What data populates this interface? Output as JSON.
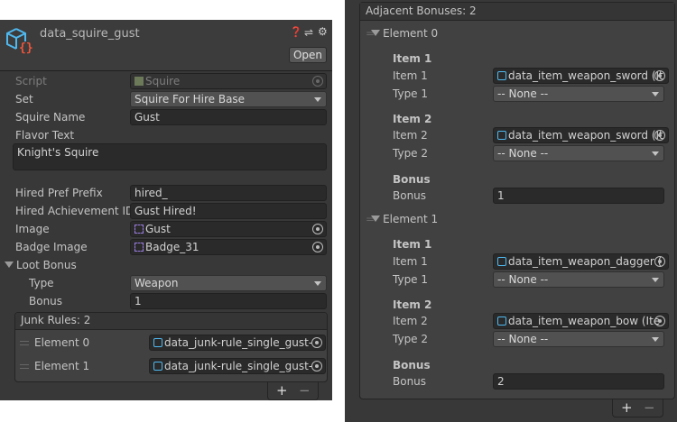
{
  "left": {
    "title": "data_squire_gust",
    "open_label": "Open",
    "fields": {
      "script": {
        "label": "Script",
        "value": "Squire"
      },
      "set": {
        "label": "Set",
        "value": "Squire For Hire Base"
      },
      "squire_name": {
        "label": "Squire Name",
        "value": "Gust"
      },
      "flavor_text": {
        "label": "Flavor Text",
        "value": "Knight's Squire"
      },
      "hired_pref_prefix": {
        "label": "Hired Pref Prefix",
        "value": "hired_"
      },
      "hired_achievement_id": {
        "label": "Hired Achievement ID",
        "value": "Gust Hired!"
      },
      "image": {
        "label": "Image",
        "value": "Gust"
      },
      "badge_image": {
        "label": "Badge Image",
        "value": "Badge_31"
      }
    },
    "loot_bonus": {
      "label": "Loot Bonus",
      "type_label": "Type",
      "type_value": "Weapon",
      "bonus_label": "Bonus",
      "bonus_value": "1"
    },
    "junk_rules": {
      "header": "Junk Rules: 2",
      "elements": [
        {
          "label": "Element 0",
          "value": "data_junk-rule_single_gust-"
        },
        {
          "label": "Element 1",
          "value": "data_junk-rule_single_gust-"
        }
      ]
    },
    "add": "+",
    "remove": "−"
  },
  "right": {
    "header": "Adjacent Bonuses: 2",
    "elements": [
      {
        "label": "Element 0",
        "item1_heading": "Item 1",
        "item1_label": "Item 1",
        "item1_value": "data_item_weapon_sword (It",
        "type1_label": "Type 1",
        "type1_value": "-- None --",
        "item2_heading": "Item 2",
        "item2_label": "Item 2",
        "item2_value": "data_item_weapon_sword (It",
        "type2_label": "Type 2",
        "type2_value": "-- None --",
        "bonus_heading": "Bonus",
        "bonus_label": "Bonus",
        "bonus_value": "1"
      },
      {
        "label": "Element 1",
        "item1_heading": "Item 1",
        "item1_label": "Item 1",
        "item1_value": "data_item_weapon_dagger (",
        "type1_label": "Type 1",
        "type1_value": "-- None --",
        "item2_heading": "Item 2",
        "item2_label": "Item 2",
        "item2_value": "data_item_weapon_bow (Ite",
        "type2_label": "Type 2",
        "type2_value": "-- None --",
        "bonus_heading": "Bonus",
        "bonus_label": "Bonus",
        "bonus_value": "2"
      }
    ],
    "add": "+",
    "remove": "−"
  }
}
